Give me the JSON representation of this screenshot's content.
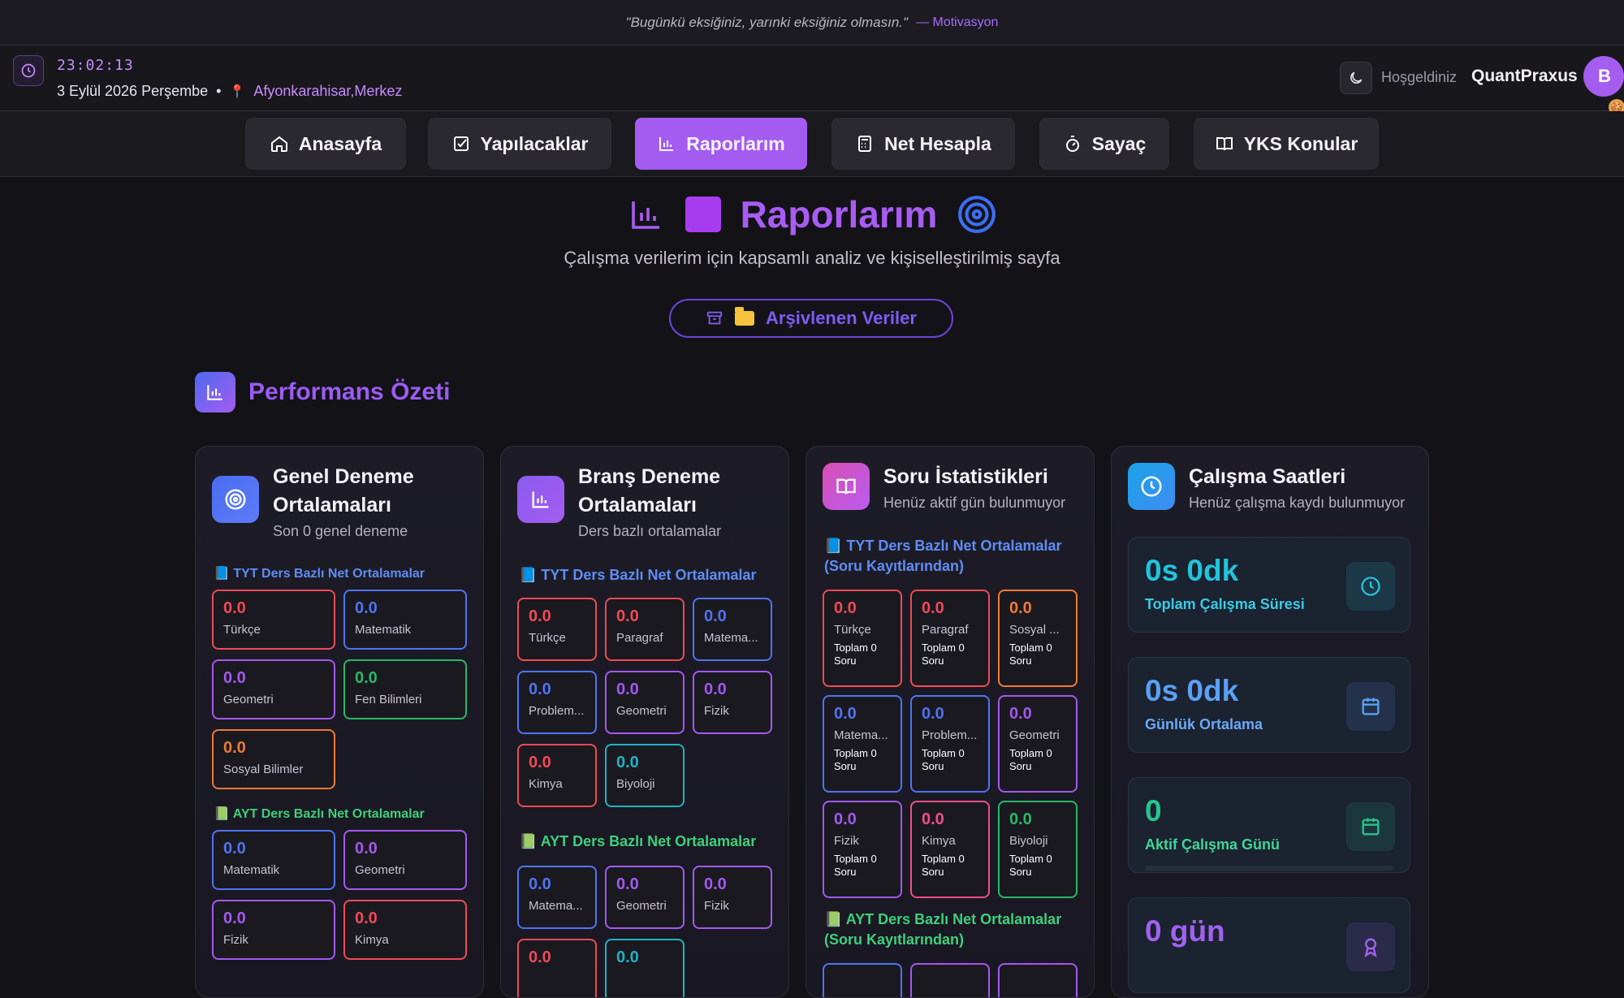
{
  "quote": {
    "text": "\"Bugünkü eksiğiniz, yarınki eksiğiniz olmasın.\"",
    "author": "— Motivasyon"
  },
  "header": {
    "time": "23:02:13",
    "date": "3 Eylül 2026 Perşembe",
    "separator": "•",
    "location": "Afyonkarahisar,Merkez",
    "welcome": "Hoşgeldiniz",
    "username": "QuantPraxus",
    "avatar_letter": "B"
  },
  "nav": [
    {
      "label": "Anasayfa",
      "icon": "home-icon"
    },
    {
      "label": "Yapılacaklar",
      "icon": "checkbox-icon"
    },
    {
      "label": "Raporlarım",
      "icon": "bar-chart-icon",
      "active": true
    },
    {
      "label": "Net Hesapla",
      "icon": "calculator-icon"
    },
    {
      "label": "Sayaç",
      "icon": "stopwatch-icon"
    },
    {
      "label": "YKS Konular",
      "icon": "book-icon"
    }
  ],
  "page": {
    "title": "Raporlarım",
    "subtitle": "Çalışma verilerim için kapsamlı analiz ve kişiselleştirilmiş sayfa",
    "archive_label": "Arşivlenen Veriler",
    "section_title": "Performans Özeti"
  },
  "colors": {
    "red": "#ef4a55",
    "blue": "#4f74f0",
    "purple": "#a358ef",
    "green": "#28b865",
    "orange": "#f07a33",
    "cyan": "#1fb2c4",
    "pink": "#f04f86"
  },
  "cards": {
    "general": {
      "title_line1": "Genel Deneme",
      "title_line2": "Ortalamaları",
      "subtitle": "Son 0 genel deneme",
      "tyt_heading": "📘 TYT Ders Bazlı Net Ortalamalar",
      "tyt": [
        {
          "value": "0.0",
          "label": "Türkçe",
          "color": "red"
        },
        {
          "value": "0.0",
          "label": "Matematik",
          "color": "blue"
        },
        {
          "value": "0.0",
          "label": "Geometri",
          "color": "purple"
        },
        {
          "value": "0.0",
          "label": "Fen Bilimleri",
          "color": "green"
        },
        {
          "value": "0.0",
          "label": "Sosyal Bilimler",
          "color": "orange"
        }
      ],
      "ayt_heading": "📗 AYT Ders Bazlı Net Ortalamalar",
      "ayt": [
        {
          "value": "0.0",
          "label": "Matematik",
          "color": "blue"
        },
        {
          "value": "0.0",
          "label": "Geometri",
          "color": "purple"
        },
        {
          "value": "0.0",
          "label": "Fizik",
          "color": "purple"
        },
        {
          "value": "0.0",
          "label": "Kimya",
          "color": "red"
        }
      ]
    },
    "branch": {
      "title_line1": "Branş Deneme",
      "title_line2": "Ortalamaları",
      "subtitle": "Ders bazlı ortalamalar",
      "tyt_heading": "📘 TYT Ders Bazlı Net Ortalamalar",
      "tyt": [
        {
          "value": "0.0",
          "label": "Türkçe",
          "color": "red"
        },
        {
          "value": "0.0",
          "label": "Paragraf",
          "color": "red"
        },
        {
          "value": "0.0",
          "label": "Matema...",
          "color": "blue"
        },
        {
          "value": "0.0",
          "label": "Problem...",
          "color": "blue"
        },
        {
          "value": "0.0",
          "label": "Geometri",
          "color": "purple"
        },
        {
          "value": "0.0",
          "label": "Fizik",
          "color": "purple"
        },
        {
          "value": "0.0",
          "label": "Kimya",
          "color": "red"
        },
        {
          "value": "0.0",
          "label": "Biyoloji",
          "color": "cyan"
        }
      ],
      "ayt_heading": "📗 AYT Ders Bazlı Net Ortalamalar",
      "ayt": [
        {
          "value": "0.0",
          "label": "Matema...",
          "color": "blue"
        },
        {
          "value": "0.0",
          "label": "Geometri",
          "color": "purple"
        },
        {
          "value": "0.0",
          "label": "Fizik",
          "color": "purple"
        },
        {
          "value": "0.0",
          "label": "",
          "color": "red"
        },
        {
          "value": "0.0",
          "label": "",
          "color": "cyan"
        }
      ]
    },
    "questions": {
      "title": "Soru İstatistikleri",
      "subtitle": "Henüz aktif gün bulunmuyor",
      "tyt_heading_line1": "📘 TYT Ders Bazlı Net Ortalamalar",
      "tyt_heading_line2": "(Soru Kayıtlarından)",
      "total_line1": "Toplam 0",
      "total_line2": "Soru",
      "tyt": [
        {
          "value": "0.0",
          "label": "Türkçe",
          "color": "red"
        },
        {
          "value": "0.0",
          "label": "Paragraf",
          "color": "red"
        },
        {
          "value": "0.0",
          "label": "Sosyal ...",
          "color": "orange"
        },
        {
          "value": "0.0",
          "label": "Matema...",
          "color": "blue"
        },
        {
          "value": "0.0",
          "label": "Problem...",
          "color": "blue"
        },
        {
          "value": "0.0",
          "label": "Geometri",
          "color": "purple"
        },
        {
          "value": "0.0",
          "label": "Fizik",
          "color": "purple"
        },
        {
          "value": "0.0",
          "label": "Kimya",
          "color": "pink"
        },
        {
          "value": "0.0",
          "label": "Biyoloji",
          "color": "green"
        }
      ],
      "ayt_heading_line1": "📗 AYT Ders Bazlı Net Ortalamalar",
      "ayt_heading_line2": "(Soru Kayıtlarından)"
    },
    "work": {
      "title": "Çalışma Saatleri",
      "subtitle": "Henüz çalışma kaydı bulunmuyor",
      "stats": [
        {
          "value": "0s 0dk",
          "label": "Toplam Çalışma Süresi",
          "color": "#22c3dd",
          "icon": "clock-icon"
        },
        {
          "value": "0s 0dk",
          "label": "Günlük Ortalama",
          "color": "#5aa0f5",
          "icon": "calendar-icon"
        },
        {
          "value": "0",
          "label": "Aktif Çalışma Günü",
          "color": "#27c48e",
          "icon": "calendar-icon"
        },
        {
          "value": "0 gün",
          "label": "",
          "color": "#a062f0",
          "icon": "award-icon"
        }
      ]
    }
  }
}
